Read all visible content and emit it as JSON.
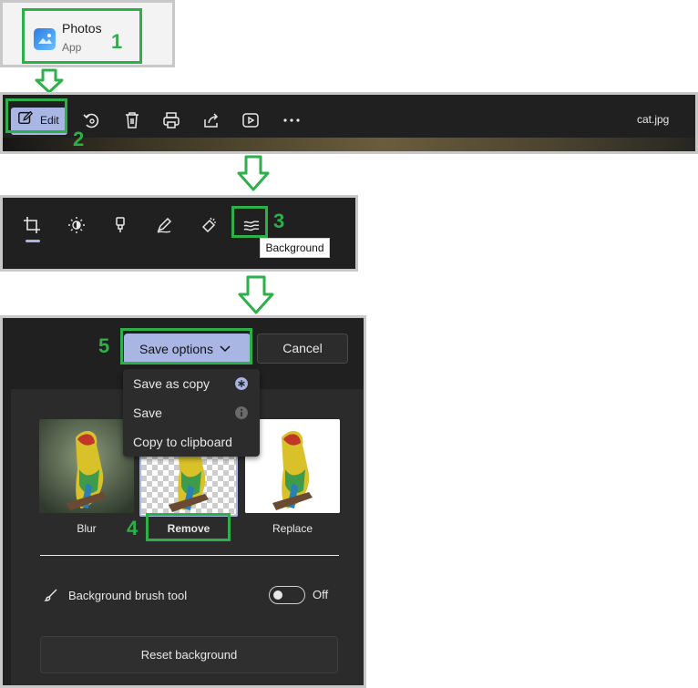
{
  "steps": [
    "1",
    "2",
    "3",
    "4",
    "5"
  ],
  "start_menu": {
    "app_name": "Photos",
    "app_type": "App"
  },
  "viewer_toolbar": {
    "edit_label": "Edit",
    "icons": [
      "edit-icon",
      "rotate-icon",
      "delete-icon",
      "print-icon",
      "share-icon",
      "slideshow-icon",
      "more-icon"
    ],
    "file_name": "cat.jpg"
  },
  "edit_toolbar": {
    "icons": [
      "crop-icon",
      "adjust-icon",
      "filter-icon",
      "markup-icon",
      "erase-icon",
      "background-icon"
    ],
    "tooltip": "Background"
  },
  "background_panel": {
    "save_options_label": "Save options",
    "cancel_label": "Cancel",
    "save_menu": [
      {
        "label": "Save as copy",
        "icon": "asterisk-icon"
      },
      {
        "label": "Save",
        "icon": "info-icon"
      },
      {
        "label": "Copy to clipboard"
      }
    ],
    "options": [
      "Blur",
      "Remove",
      "Replace"
    ],
    "selected_option": "Remove",
    "brush_label": "Background brush tool",
    "brush_state": "Off",
    "reset_label": "Reset background"
  },
  "colors": {
    "highlight": "#2db04a",
    "accent": "#a9b6e4",
    "dark_bg": "#202020"
  }
}
